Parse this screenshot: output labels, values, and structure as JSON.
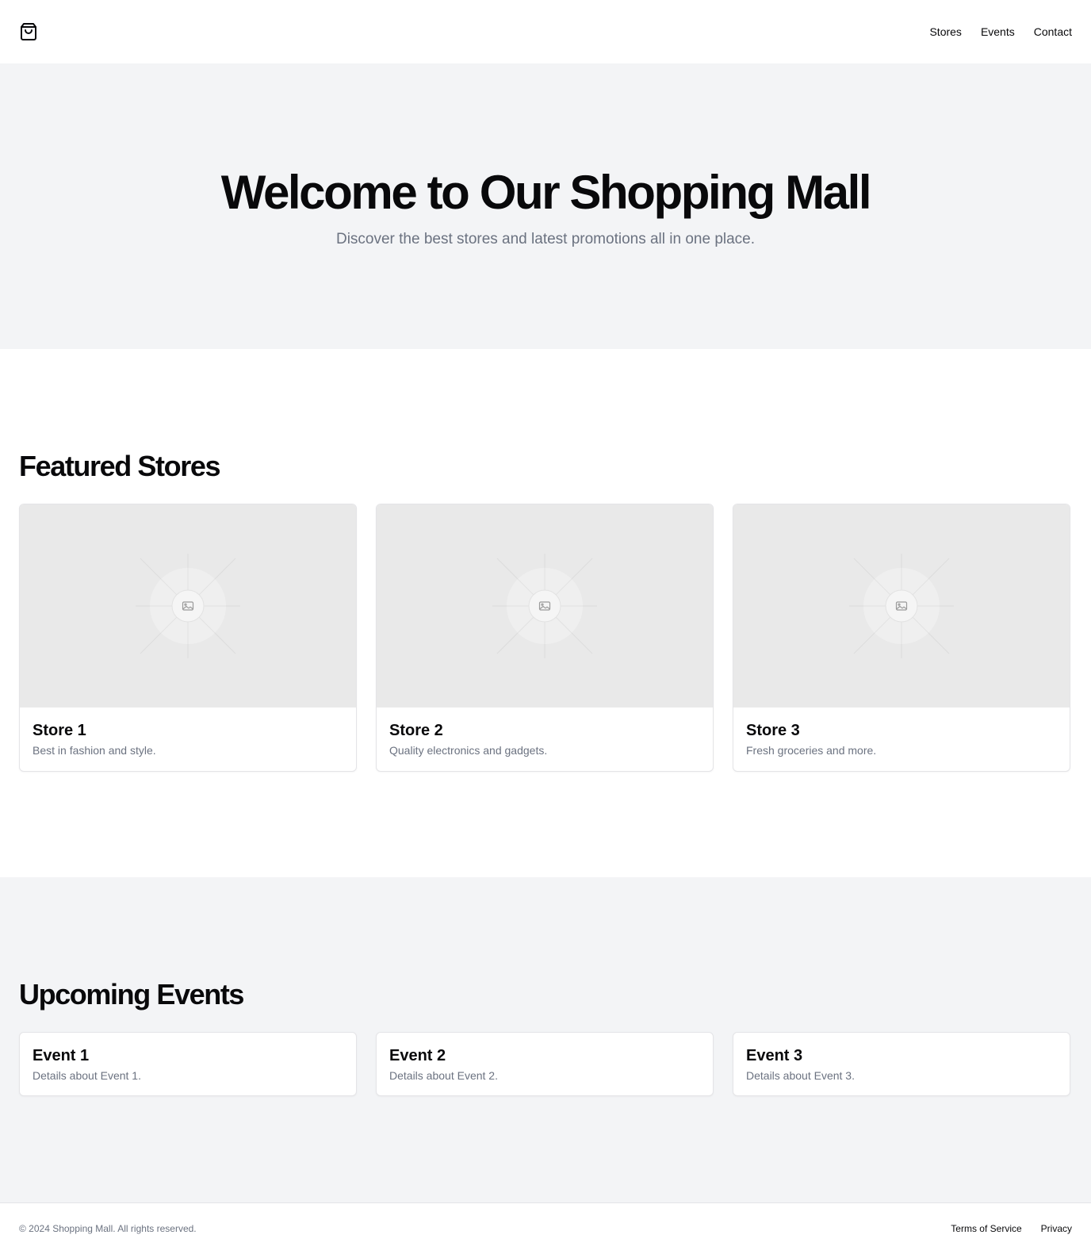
{
  "header": {
    "logo_icon": "shopping-bag-icon",
    "nav": [
      {
        "label": "Stores"
      },
      {
        "label": "Events"
      },
      {
        "label": "Contact"
      }
    ]
  },
  "hero": {
    "title": "Welcome to Our Shopping Mall",
    "subtitle": "Discover the best stores and latest promotions all in one place."
  },
  "stores": {
    "title": "Featured Stores",
    "items": [
      {
        "name": "Store 1",
        "description": "Best in fashion and style.",
        "image_icon": "image-placeholder-icon"
      },
      {
        "name": "Store 2",
        "description": "Quality electronics and gadgets.",
        "image_icon": "image-placeholder-icon"
      },
      {
        "name": "Store 3",
        "description": "Fresh groceries and more.",
        "image_icon": "image-placeholder-icon"
      }
    ]
  },
  "events": {
    "title": "Upcoming Events",
    "items": [
      {
        "name": "Event 1",
        "details": "Details about Event 1."
      },
      {
        "name": "Event 2",
        "details": "Details about Event 2."
      },
      {
        "name": "Event 3",
        "details": "Details about Event 3."
      }
    ]
  },
  "footer": {
    "copyright": "© 2024 Shopping Mall. All rights reserved.",
    "links": [
      {
        "label": "Terms of Service"
      },
      {
        "label": "Privacy"
      }
    ]
  },
  "colors": {
    "text": "#09090b",
    "muted": "#6b7280",
    "section_bg": "#f3f4f6",
    "placeholder_bg": "#e9e9e9",
    "border": "#e4e4e7"
  }
}
